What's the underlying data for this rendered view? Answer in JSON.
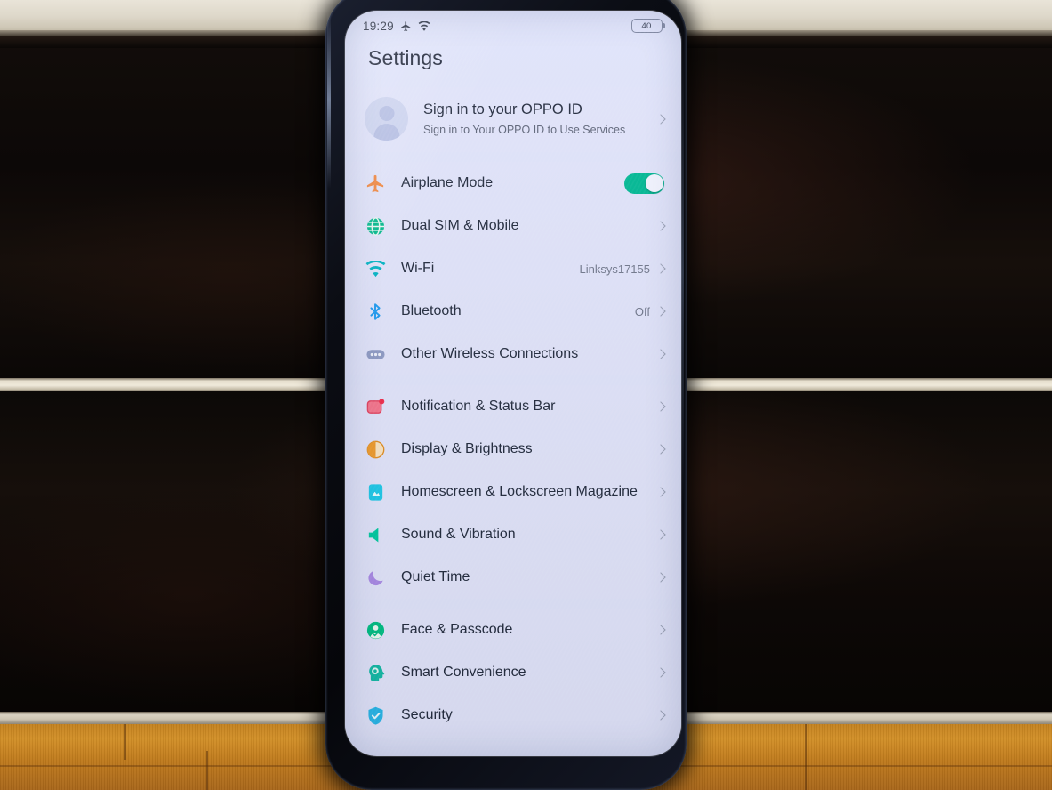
{
  "scene": {
    "description": "photo of an OPPO phone held in front of a dark wooden bookcase with cream trim and a hardwood floor"
  },
  "phone": {
    "status_bar": {
      "time": "19:29",
      "airplane_icon": "airplane-icon",
      "wifi_icon": "wifi-icon",
      "battery_level": "40"
    },
    "page_title": "Settings",
    "account": {
      "title": "Sign in to your OPPO ID",
      "subtitle": "Sign in to Your OPPO ID to Use Services",
      "avatar_icon": "avatar-placeholder-icon",
      "chevron": "chevron-right-icon"
    },
    "groups": [
      {
        "name": "connectivity",
        "items": [
          {
            "label": "Airplane Mode",
            "icon": "airplane-icon",
            "icon_color": "#F0873F",
            "control": "toggle",
            "toggle_on": true,
            "value": ""
          },
          {
            "label": "Dual SIM & Mobile",
            "icon": "globe-icon",
            "icon_color": "#00B98C",
            "control": "chevron",
            "value": ""
          },
          {
            "label": "Wi-Fi",
            "icon": "wifi-icon",
            "icon_color": "#00B4C4",
            "control": "chevron",
            "value": "Linksys17155"
          },
          {
            "label": "Bluetooth",
            "icon": "bluetooth-icon",
            "icon_color": "#1E9BF0",
            "control": "chevron",
            "value": "Off"
          },
          {
            "label": "Other Wireless Connections",
            "icon": "other-wireless-icon",
            "icon_color": "#8D9AC4",
            "control": "chevron",
            "value": ""
          }
        ]
      },
      {
        "name": "personalization",
        "items": [
          {
            "label": "Notification & Status Bar",
            "icon": "notification-badge-icon",
            "icon_color": "#F0607A",
            "control": "chevron",
            "value": ""
          },
          {
            "label": "Display & Brightness",
            "icon": "display-brightness-icon",
            "icon_color": "#EE9A2B",
            "control": "chevron",
            "value": ""
          },
          {
            "label": "Homescreen & Lockscreen Magazine",
            "icon": "homescreen-magazine-icon",
            "icon_color": "#1EC8E8",
            "control": "chevron",
            "value": ""
          },
          {
            "label": "Sound & Vibration",
            "icon": "sound-vibration-icon",
            "icon_color": "#00C9A0",
            "control": "chevron",
            "value": ""
          },
          {
            "label": "Quiet Time",
            "icon": "moon-icon",
            "icon_color": "#A98AE6",
            "control": "chevron",
            "value": ""
          }
        ]
      },
      {
        "name": "security",
        "items": [
          {
            "label": "Face & Passcode",
            "icon": "face-passcode-icon",
            "icon_color": "#00BE84",
            "control": "chevron",
            "value": ""
          },
          {
            "label": "Smart Convenience",
            "icon": "smart-convenience-icon",
            "icon_color": "#14B9A6",
            "control": "chevron",
            "value": ""
          },
          {
            "label": "Security",
            "icon": "shield-check-icon",
            "icon_color": "#29B6E8",
            "control": "chevron",
            "value": ""
          }
        ]
      }
    ]
  },
  "colors": {
    "screen_background": "#DFE3FA",
    "row_background": "#E0E4FA",
    "primary_text": "#212A3D",
    "secondary_text": "#70778C",
    "toggle_on": "#00B894",
    "bezel": "#0B0D14"
  }
}
